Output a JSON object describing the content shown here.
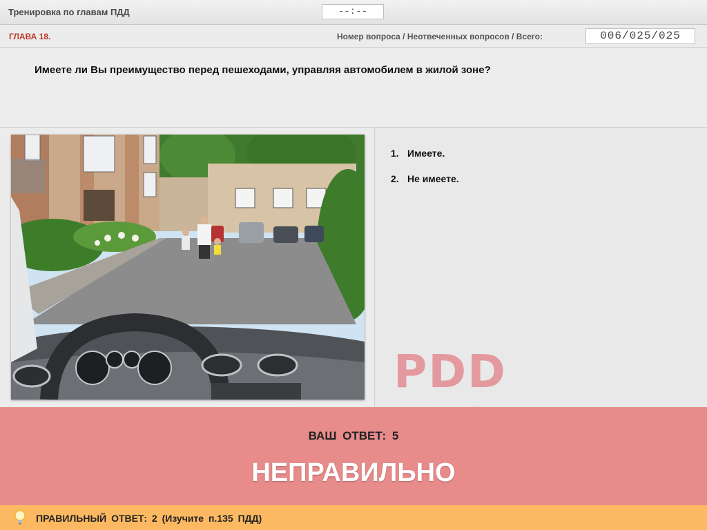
{
  "header": {
    "app_title": "Тренировка по главам ПДД",
    "timer": "--:--"
  },
  "chapter_row": {
    "chapter": "ГЛАВА 18.",
    "counter_label": "Номер вопроса / Неотвеченных вопросов / Всего:",
    "counter": "006/025/025"
  },
  "question": {
    "text": "Имеете ли Вы преимущество перед пешеходами, управляя автомобилем в жилой зоне?"
  },
  "answers": [
    {
      "num": "1.",
      "label": "Имеете."
    },
    {
      "num": "2.",
      "label": "Не имеете."
    }
  ],
  "watermark": "PDD HELPER",
  "result": {
    "your_answer": "ВАШ ОТВЕТ: 5",
    "verdict": "НЕПРАВИЛЬНО"
  },
  "correct": {
    "text": "ПРАВИЛЬНЫЙ ОТВЕТ: 2 (Изучите п.135 ПДД)",
    "icon": "lightbulb-icon"
  },
  "colors": {
    "result_bg": "#e88b8b",
    "correct_bg": "#fdb961",
    "chapter": "#c0392b"
  }
}
